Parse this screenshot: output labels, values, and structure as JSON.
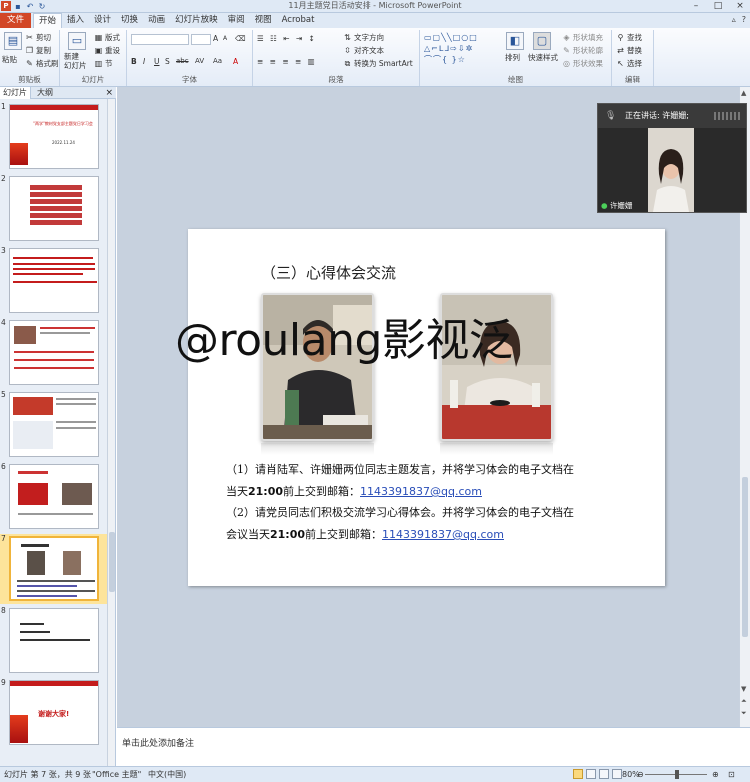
{
  "window": {
    "title": "11月主题党日活动安排 - Microsoft PowerPoint",
    "min_label": "–",
    "max_label": "□",
    "close_label": "×"
  },
  "ribbon_tabs": {
    "file": "文件",
    "tabs": [
      "开始",
      "插入",
      "设计",
      "切换",
      "动画",
      "幻灯片放映",
      "审阅",
      "视图",
      "Acrobat"
    ]
  },
  "ribbon": {
    "clipboard": {
      "label": "剪贴板",
      "paste": "粘贴",
      "cut": "剪切",
      "copy": "复制",
      "format_painter": "格式刷"
    },
    "slides": {
      "label": "幻灯片",
      "new_slide": "新建\n幻灯片",
      "layout": "版式",
      "reset": "重设",
      "section": "节"
    },
    "font": {
      "label": "字体",
      "bold": "B",
      "italic": "I",
      "underline": "U",
      "strike": "S",
      "shadow": "abc",
      "spacing": "AV",
      "case": "Aa",
      "grow": "A",
      "shrink": "A"
    },
    "paragraph": {
      "label": "段落",
      "text_direction": "文字方向",
      "align_text": "对齐文本",
      "smartart": "转换为 SmartArt"
    },
    "drawing": {
      "label": "绘图",
      "arrange": "排列",
      "quick_styles": "快速样式",
      "shape_fill": "形状填充",
      "shape_outline": "形状轮廓",
      "shape_effects": "形状效果"
    },
    "editing": {
      "label": "编辑",
      "find": "查找",
      "replace": "替换",
      "select": "选择"
    }
  },
  "left_pane": {
    "tab_slides": "幻灯片",
    "tab_outline": "大纲",
    "close": "×",
    "slide_numbers": [
      "1",
      "2",
      "3",
      "4",
      "5",
      "6",
      "7",
      "8",
      "9"
    ],
    "selected_index": 7,
    "thumb1_title": "\"两学\"教材党支部主题党日学习会",
    "thumb1_date": "2022.11.24",
    "thumb9_text": "谢谢大家!"
  },
  "slide": {
    "title": "（三）心得体会交流",
    "para1_line1": "（1）请肖陆军、许姗姗两位同志主题发言，并将学习体会的电子文档在",
    "para1_line2_prefix": "当天",
    "para1_line2_time": "21:00",
    "para1_line2_mid": "前上交到邮箱：",
    "para1_email": "1143391837@qq.com",
    "para2_line1": "（2）请党员同志们积极交流学习心得体会。并将学习体会的电子文档在",
    "para2_line2_prefix": "会议当天",
    "para2_line2_time": "21:00",
    "para2_line2_mid": "前上交到邮箱：",
    "para2_email": "1143391837@qq.com"
  },
  "watermark": "@roulang影视泛",
  "video_panel": {
    "speaking_label": "正在讲话: 许姗姗;",
    "participant_name": "许姗姗"
  },
  "notes_placeholder": "单击此处添加备注",
  "status_bar": {
    "slide_info": "幻灯片 第 7 张，共 9 张",
    "theme": "\"Office 主题\"",
    "language": "中文(中国)",
    "zoom": "80%"
  }
}
